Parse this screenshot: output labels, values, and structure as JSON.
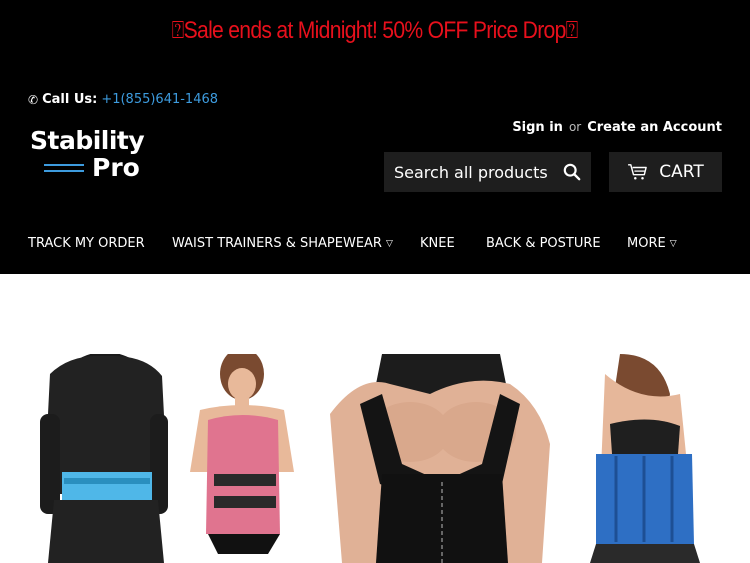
{
  "promo": {
    "text": "⍰Sale ends at Midnight! 50% OFF Price Drop⍰"
  },
  "header": {
    "call_label": "Call Us:",
    "phone": "+1(855)641-1468",
    "logo_top": "Stability",
    "logo_bottom": "Pro",
    "sign_in": "Sign in",
    "or": "or",
    "create_account": "Create an Account",
    "search_placeholder": "Search all products",
    "cart_label": "CART"
  },
  "nav": {
    "items": [
      {
        "label": "TRACK MY ORDER"
      },
      {
        "label": "WAIST TRAINERS & SHAPEWEAR"
      },
      {
        "label": "KNEE"
      },
      {
        "label": "BACK & POSTURE"
      },
      {
        "label": "MORE"
      }
    ]
  },
  "colors": {
    "accent": "#3d9bde",
    "promo": "#e8101c",
    "header_bg": "#000000",
    "button_bg": "#1e1e1e"
  }
}
